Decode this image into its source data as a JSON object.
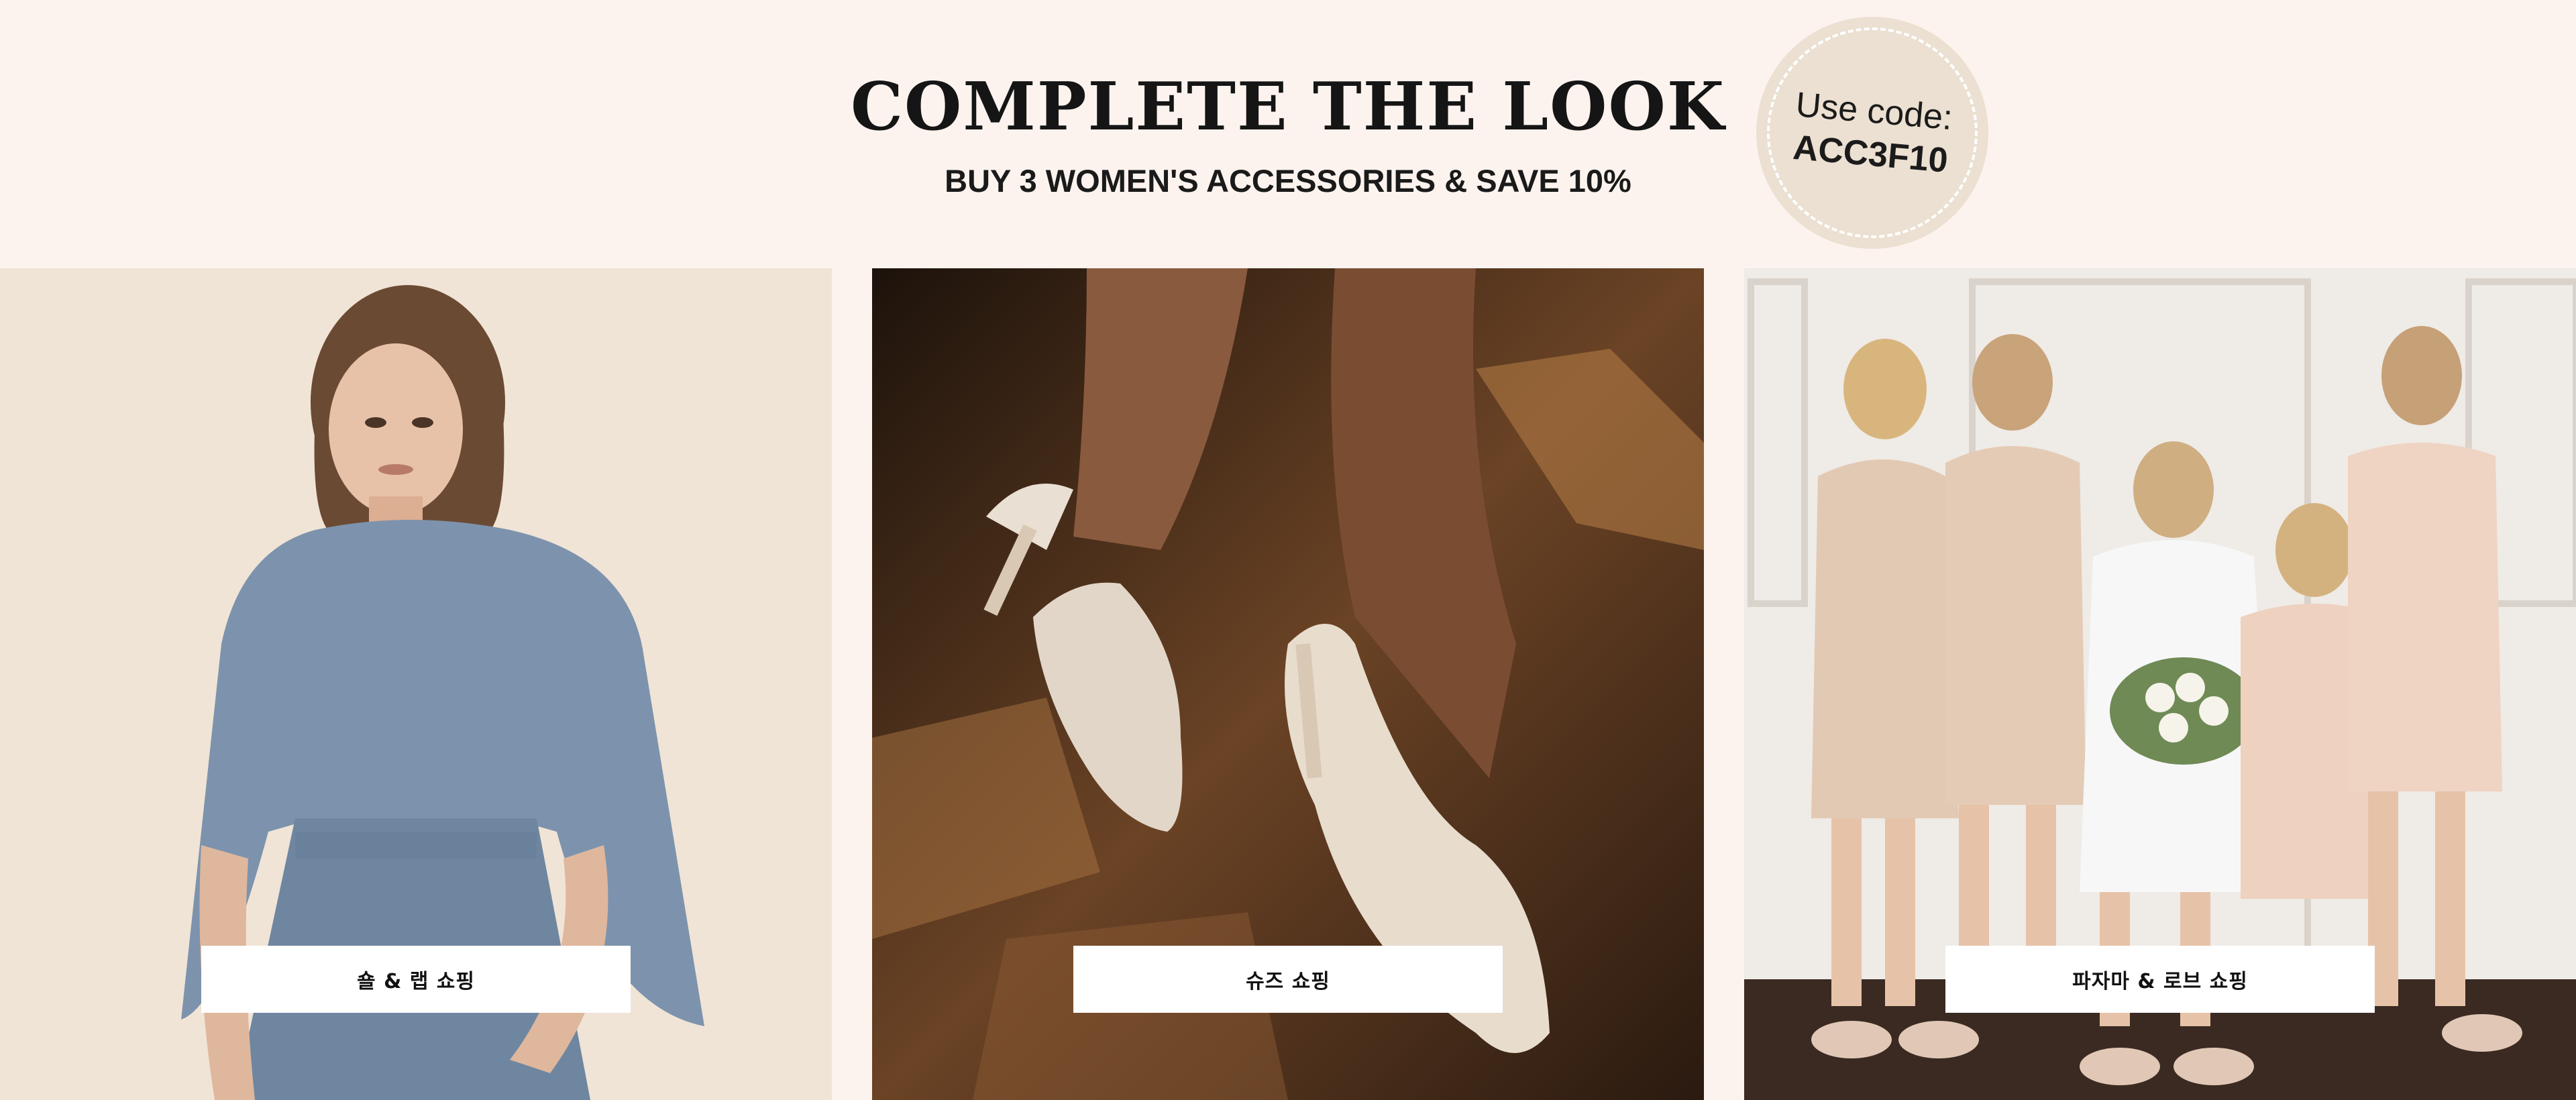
{
  "header": {
    "title": "COMPLETE THE LOOK",
    "subtitle": "BUY 3 WOMEN'S ACCESSORIES & SAVE 10%"
  },
  "promo": {
    "label": "Use code:",
    "code": "ACC3F10"
  },
  "panels": [
    {
      "cta": "숄 & 랩 쇼핑",
      "image": "model-in-blue-cape-wrap"
    },
    {
      "cta": "슈즈 쇼핑",
      "image": "embellished-slingback-heels"
    },
    {
      "cta": "파자마 & 로브 쇼핑",
      "image": "bridal-party-in-satin-robes"
    }
  ],
  "colors": {
    "background": "#fdf3ee",
    "promo_badge": "#ebe0d1",
    "button_bg": "#ffffff",
    "text": "#151515"
  }
}
